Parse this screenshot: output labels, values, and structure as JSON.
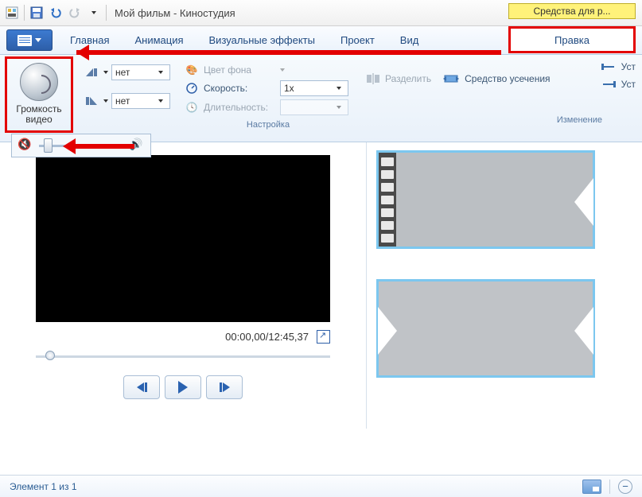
{
  "titlebar": {
    "title": "Мой фильм - Киностудия",
    "context_tab": "Средства для р..."
  },
  "tabs": {
    "home": "Главная",
    "animation": "Анимация",
    "visual_fx": "Визуальные эффекты",
    "project": "Проект",
    "view": "Вид",
    "edit": "Правка"
  },
  "ribbon": {
    "volume_group_label": "Громкость видео",
    "fade_in_value": "нет",
    "fade_out_value": "нет",
    "bgcolor_label": "Цвет фона",
    "speed_label": "Скорость:",
    "speed_value": "1x",
    "duration_label": "Длительность:",
    "settings_group": "Настройка",
    "split_label": "Разделить",
    "trim_label": "Средство усечения",
    "set_start": "Уст",
    "set_end": "Уст",
    "edit_group": "Изменение"
  },
  "preview": {
    "time": "00:00,00/12:45,37"
  },
  "status": {
    "item": "Элемент 1 из 1"
  }
}
